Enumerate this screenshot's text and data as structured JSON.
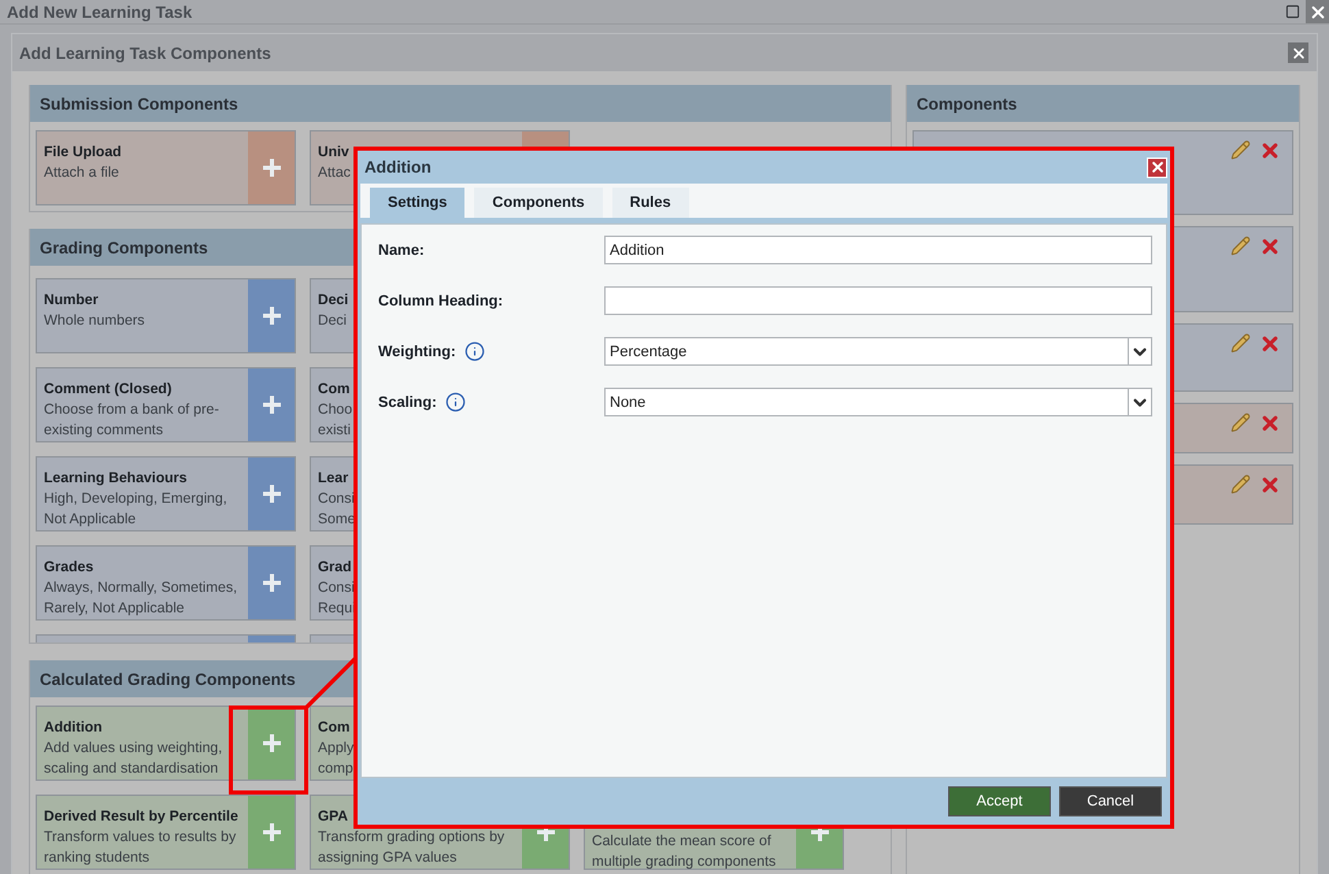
{
  "window": {
    "title": "Add New Learning Task"
  },
  "inner_window": {
    "title": "Add Learning Task Components"
  },
  "sections": [
    {
      "title": "Submission Components",
      "kind": "submission",
      "cards": [
        {
          "title": "File Upload",
          "description": [
            "Attach a file"
          ]
        },
        {
          "title": "Univ",
          "description": [
            "Attac"
          ]
        }
      ]
    },
    {
      "title": "Grading Components",
      "kind": "grading",
      "cards": [
        {
          "title": "Number",
          "description": [
            "Whole numbers"
          ]
        },
        {
          "title": "Deci",
          "description": [
            "Deci"
          ]
        },
        {
          "kind": "hidden"
        },
        {
          "title": "Comment (Closed)",
          "description": [
            "Choose from a bank of pre-",
            "existing comments"
          ]
        },
        {
          "title": "Com",
          "description": [
            "Choo",
            "existi"
          ]
        },
        {
          "kind": "hidden"
        },
        {
          "title": "Learning Behaviours",
          "description": [
            "High, Developing, Emerging,",
            "Not Applicable"
          ]
        },
        {
          "title": "Lear",
          "description": [
            "Consi",
            "Some"
          ]
        },
        {
          "kind": "hidden"
        },
        {
          "title": "Grades",
          "description": [
            "Always, Normally, Sometimes,",
            "Rarely, Not Applicable"
          ]
        },
        {
          "title": "Grad",
          "description": [
            "Consi",
            "Requi"
          ]
        },
        {
          "kind": "hidden"
        },
        {
          "kind": "stub"
        },
        {
          "kind": "stub"
        }
      ]
    },
    {
      "title": "Calculated Grading Components",
      "kind": "calculated",
      "cards": [
        {
          "title": "Addition",
          "description": [
            "Add values using weighting,",
            "scaling and standardisation"
          ]
        },
        {
          "title": "Com",
          "description": [
            "Apply",
            "comp"
          ]
        },
        {
          "kind": "hidden"
        },
        {
          "title": "Derived Result by Percentile",
          "description": [
            "Transform values to results by",
            "ranking students"
          ]
        },
        {
          "title": "GPA",
          "description": [
            "Transform grading options by",
            "assigning GPA values"
          ]
        },
        {
          "description": [
            "Calculate the mean score of",
            "multiple grading components"
          ]
        }
      ]
    }
  ],
  "components_panel": {
    "title": "Components",
    "items": [
      {
        "color": "#a9aeb8"
      },
      {
        "color": "#a9aeb8"
      },
      {
        "color": "#a9aeb8"
      },
      {
        "color": "#b5aaa7"
      },
      {
        "color": "#b5aaa7"
      }
    ]
  },
  "dialog": {
    "title": "Addition",
    "tabs": [
      {
        "label": "Settings",
        "selected": true
      },
      {
        "label": "Components",
        "selected": false
      },
      {
        "label": "Rules",
        "selected": false
      }
    ],
    "fields": [
      {
        "kind": "text",
        "label": "Name:",
        "value": "Addition"
      },
      {
        "kind": "text",
        "label": "Column Heading:"
      },
      {
        "kind": "select",
        "label": "Weighting:",
        "value": "Percentage",
        "info": true
      },
      {
        "kind": "select",
        "label": "Scaling:",
        "value": "None",
        "info": true
      }
    ],
    "buttons": [
      {
        "label": "Accept",
        "kind": "primary"
      },
      {
        "label": "Cancel",
        "kind": "secondary"
      }
    ]
  }
}
